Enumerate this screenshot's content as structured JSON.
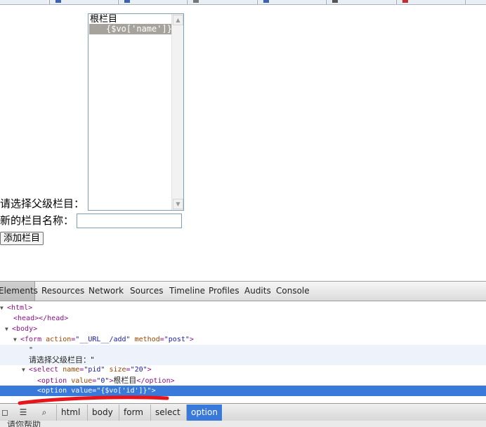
{
  "page": {
    "root_option": "根栏目",
    "selected_option": "{$vo['name']}",
    "parent_label": "请选择父级栏目：",
    "name_label": "新的栏目名称：",
    "name_input_value": "",
    "submit_button": "添加栏目"
  },
  "devtools": {
    "tabs": [
      "Elements",
      "Resources",
      "Network",
      "Sources",
      "Timeline",
      "Profiles",
      "Audits",
      "Console"
    ],
    "active_tab": "Elements",
    "tree": {
      "html": "<html>",
      "head": "<head></head>",
      "body": "<body>",
      "form_open": "<form",
      "form_action_attr": "action",
      "form_action_val": "\"__URL__/add\"",
      "form_method_attr": "method",
      "form_method_val": "\"post\"",
      "form_close": ">",
      "text_quote": "\"",
      "text_label": "请选择父级栏目：\"",
      "select_open": "<select",
      "select_name_attr": "name",
      "select_name_val": "\"pid\"",
      "select_size_attr": "size",
      "select_size_val": "\"20\"",
      "select_close": ">",
      "option1_open": "<option",
      "option1_value_attr": "value",
      "option1_value_val": "\"0\"",
      "option1_close": ">",
      "option1_text": "根栏目",
      "option1_end": "</option>",
      "option2_open": "<option",
      "option2_value_attr": "value",
      "option2_value_val": "\"{$vo['id']}\"",
      "option2_close": ">"
    },
    "breadcrumbs": [
      "html",
      "body",
      "form",
      "select",
      "option"
    ],
    "active_crumb": "option",
    "bottom_text": "请你帮助"
  },
  "colors": {
    "selection": "#3879d9",
    "option_selected": "#a6a39c",
    "annotation": "#e8141b"
  },
  "icons": [
    "dock-icon",
    "console-drawer-icon",
    "search-icon"
  ]
}
